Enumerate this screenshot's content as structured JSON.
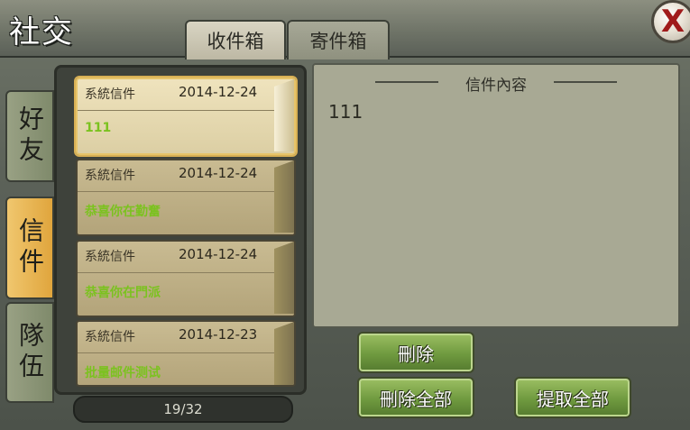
{
  "window": {
    "title": "社交",
    "close_symbol": "X"
  },
  "tabs": [
    {
      "label": "收件箱",
      "active": true
    },
    {
      "label": "寄件箱",
      "active": false
    }
  ],
  "side_tabs": [
    {
      "label": "好友",
      "active": false
    },
    {
      "label": "信件",
      "active": true
    },
    {
      "label": "隊伍",
      "active": false
    }
  ],
  "mails": [
    {
      "sender": "系統信件",
      "date": "2014-12-24",
      "subject": "111",
      "selected": true
    },
    {
      "sender": "系統信件",
      "date": "2014-12-24",
      "subject": "恭喜你在勤奮",
      "selected": false
    },
    {
      "sender": "系統信件",
      "date": "2014-12-24",
      "subject": "恭喜你在門派",
      "selected": false
    },
    {
      "sender": "系統信件",
      "date": "2014-12-23",
      "subject": "批量邮件测试",
      "selected": false
    }
  ],
  "pager": {
    "count": "19/32"
  },
  "content": {
    "header": "信件內容",
    "body": "111"
  },
  "buttons": {
    "delete": "刪除",
    "delete_all": "刪除全部",
    "take_all": "提取全部"
  },
  "colors": {
    "subject_green": "#7bc21f",
    "active_tab": "#e0a53d",
    "button_green": "#6f9a3f"
  }
}
